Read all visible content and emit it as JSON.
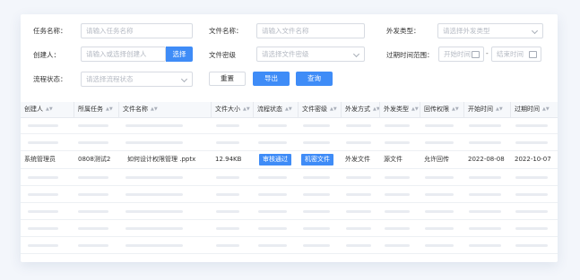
{
  "filters": {
    "task_name": {
      "label": "任务名称：",
      "placeholder": "请输入任务名称"
    },
    "file_name": {
      "label": "文件名称：",
      "placeholder": "请输入文件名称"
    },
    "send_type": {
      "label": "外发类型：",
      "placeholder": "请选择外发类型"
    },
    "creator": {
      "label": "创建人：",
      "placeholder": "请输入或选择创建人",
      "select_label": "选择"
    },
    "file_secret": {
      "label": "文件密级",
      "placeholder": "请选择文件密级"
    },
    "expire_range": {
      "label": "过期时间范围：",
      "start_placeholder": "开始时间",
      "separator": "-",
      "end_placeholder": "结束时间"
    },
    "flow_status": {
      "label": "流程状态：",
      "placeholder": "请选择流程状态"
    }
  },
  "actions": {
    "reset": "重置",
    "export": "导出",
    "query": "查询"
  },
  "table": {
    "columns": [
      "创建人",
      "所属任务",
      "文件名称",
      "文件大小",
      "流程状态",
      "文件密级",
      "外发方式",
      "外发类型",
      "回传权限",
      "开始时间",
      "过期时间"
    ],
    "row": {
      "creator": "系统管理员",
      "task": "0808测试2",
      "file_name": "如何设计权限管理 .pptx",
      "file_size": "12.94KB",
      "flow_status": "审核通过",
      "file_secret": "机密文件",
      "send_method": "外发文件",
      "send_type": "源文件",
      "return_permission": "允许回传",
      "start_time": "2022-08-08",
      "expire_time": "2022-10-07"
    }
  },
  "colors": {
    "accent": "#3f8cf7",
    "placeholder_bar": "#e9ecf1"
  }
}
